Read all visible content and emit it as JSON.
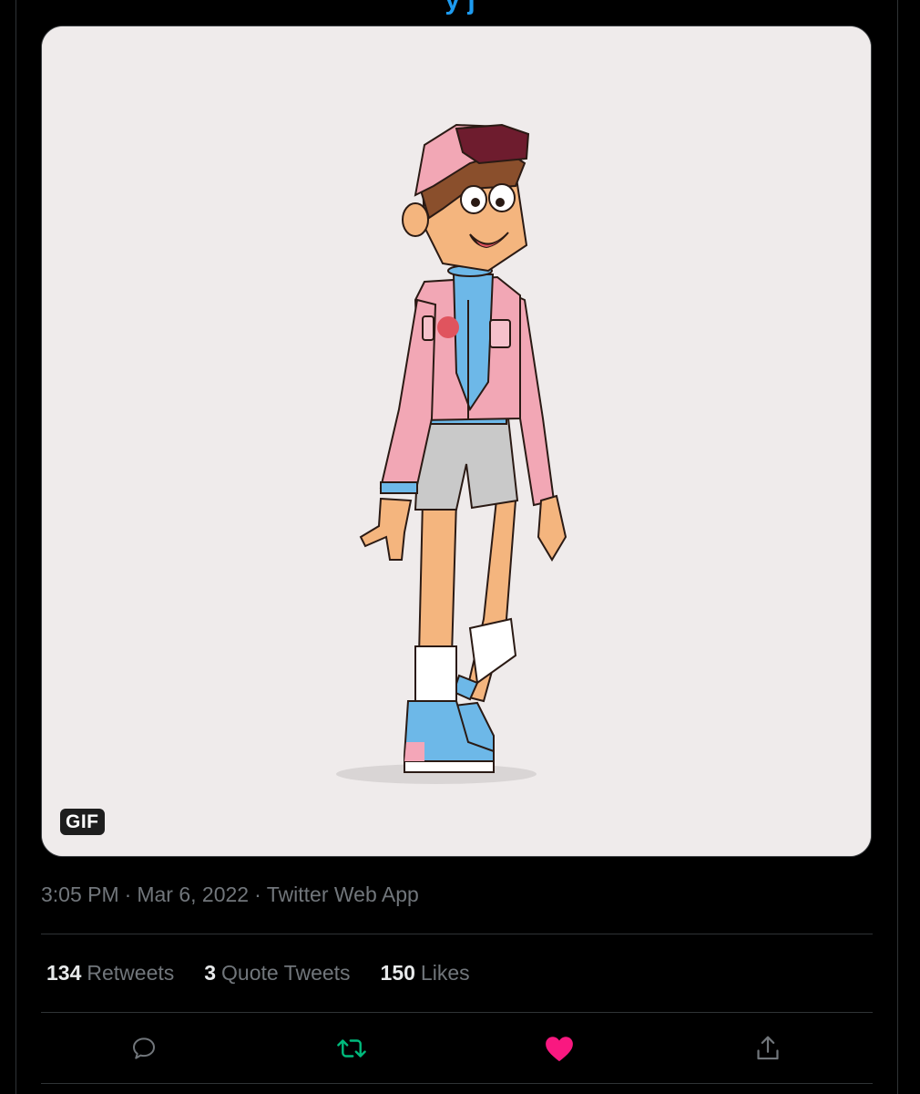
{
  "header": {
    "clipped_title": "y     j"
  },
  "media": {
    "badge": "GIF",
    "alt_icon": "animated-character-gif"
  },
  "tweet_meta": {
    "time": "3:05 PM",
    "separator": "·",
    "date": "Mar 6, 2022",
    "source": "Twitter Web App"
  },
  "stats": {
    "retweets": {
      "count": "134",
      "label": "Retweets"
    },
    "quotes": {
      "count": "3",
      "label": "Quote Tweets"
    },
    "likes": {
      "count": "150",
      "label": "Likes"
    }
  },
  "actions": {
    "reply": {
      "icon": "reply-icon",
      "color": "#71767b"
    },
    "retweet": {
      "icon": "retweet-icon",
      "color": "#00ba7c"
    },
    "like": {
      "icon": "heart-icon",
      "color": "#f91880"
    },
    "share": {
      "icon": "share-icon",
      "color": "#71767b"
    }
  },
  "colors": {
    "background": "#000000",
    "text": "#e7e9ea",
    "muted": "#71767b",
    "link": "#1d9bf0"
  }
}
